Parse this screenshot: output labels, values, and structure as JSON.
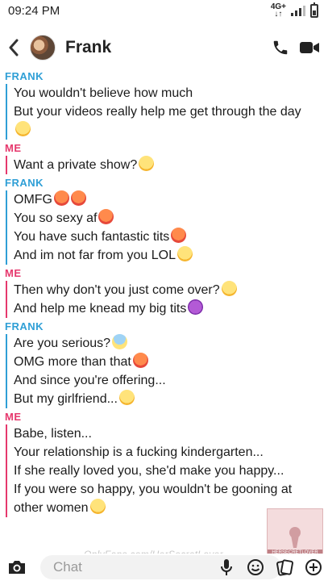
{
  "status_bar": {
    "time": "09:24 PM",
    "network": "4G+"
  },
  "header": {
    "contact_name": "Frank"
  },
  "chat": {
    "groups": [
      {
        "sender": "FRANK",
        "side": "them",
        "messages": [
          {
            "text": "You wouldn't believe how much",
            "emoji": ""
          },
          {
            "text": "But your videos really help me get through the day",
            "emoji": ""
          },
          {
            "text": "",
            "emoji": "grinning-sweat"
          }
        ]
      },
      {
        "sender": "ME",
        "side": "me",
        "messages": [
          {
            "text": "Want a private show?",
            "emoji": "smirk"
          }
        ]
      },
      {
        "sender": "FRANK",
        "side": "them",
        "messages": [
          {
            "text": "OMFG",
            "emoji": "hot-face hot-face"
          },
          {
            "text": "You so sexy af",
            "emoji": "hot-face"
          },
          {
            "text": "You have such fantastic tits",
            "emoji": "hot-face"
          },
          {
            "text": "And im not far from you LOL",
            "emoji": "grinning-sweat"
          }
        ]
      },
      {
        "sender": "ME",
        "side": "me",
        "messages": [
          {
            "text": "Then why don't you just come over?",
            "emoji": "smirk"
          },
          {
            "text": "And help me knead my big tits",
            "emoji": "smiling-devil"
          }
        ]
      },
      {
        "sender": "FRANK",
        "side": "them",
        "messages": [
          {
            "text": "Are you serious?",
            "emoji": "screaming"
          },
          {
            "text": "OMG more than that",
            "emoji": "hot-face"
          },
          {
            "text": "And since you're offering...",
            "emoji": ""
          },
          {
            "text": "But my girlfriend...",
            "emoji": "grimace"
          }
        ]
      },
      {
        "sender": "ME",
        "side": "me",
        "messages": [
          {
            "text": "Babe, listen...",
            "emoji": ""
          },
          {
            "text": "Your relationship is a fucking kindergarten...",
            "emoji": ""
          },
          {
            "text": "If she really loved you, she'd make you happy...",
            "emoji": ""
          },
          {
            "text": "If you were so happy, you wouldn't be gooning at",
            "emoji": ""
          },
          {
            "text": "other women",
            "emoji": "smirk"
          }
        ]
      }
    ]
  },
  "watermark": {
    "url": "OnlyFans.com/HerSecretLover",
    "badge": "HERSECRETLOVER"
  },
  "bottom_bar": {
    "chat_placeholder": "Chat"
  },
  "colors": {
    "them": "#2f9fd6",
    "me": "#e6386d"
  }
}
